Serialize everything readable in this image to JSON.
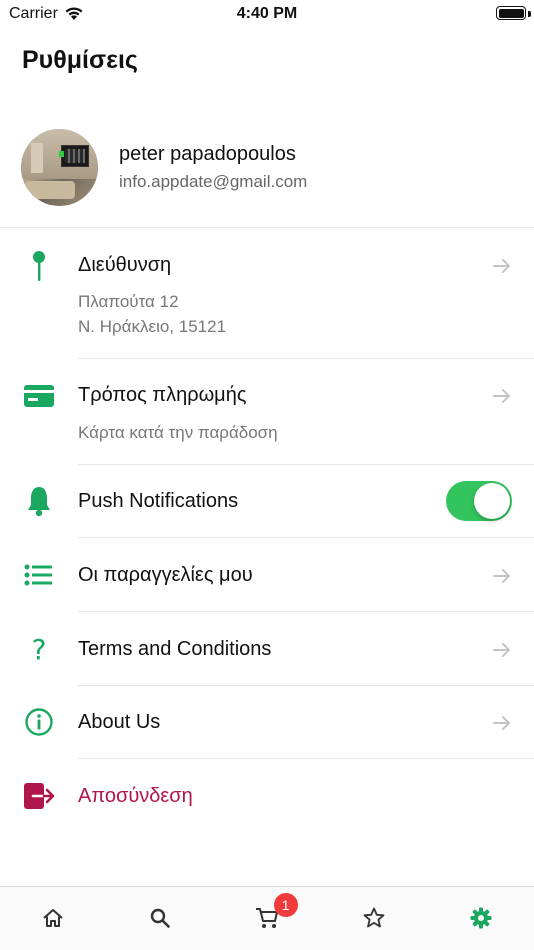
{
  "status_bar": {
    "carrier": "Carrier",
    "time": "4:40 PM"
  },
  "page": {
    "title": "Ρυθμίσεις"
  },
  "profile": {
    "name": "peter papadopoulos",
    "email": "info.appdate@gmail.com"
  },
  "settings": {
    "address": {
      "label": "Διεύθυνση",
      "line1": "Πλαπούτα 12",
      "line2": "Ν. Ηράκλειο, 15121",
      "icon": "location-pin-icon"
    },
    "payment": {
      "label": "Τρόπος πληρωμής",
      "value": "Κάρτα κατά την παράδοση",
      "icon": "credit-card-icon"
    },
    "push": {
      "label": "Push Notifications",
      "enabled": true,
      "icon": "bell-icon"
    },
    "orders": {
      "label": "Οι παραγγελίες μου",
      "icon": "list-icon"
    },
    "terms": {
      "label": "Terms and Conditions",
      "icon": "question-mark-icon"
    },
    "about": {
      "label": "About Us",
      "icon": "info-icon"
    },
    "logout": {
      "label": "Αποσύνδεση",
      "icon": "logout-icon"
    }
  },
  "tab_bar": {
    "cart_badge": "1",
    "tabs": [
      "home-icon",
      "search-icon",
      "cart-icon",
      "star-icon",
      "gear-icon"
    ],
    "active_tab": "gear-icon"
  },
  "colors": {
    "accent": "#1aa861",
    "toggle_on": "#33c45e",
    "logout": "#b0154c",
    "badge": "#ef3b3b"
  }
}
